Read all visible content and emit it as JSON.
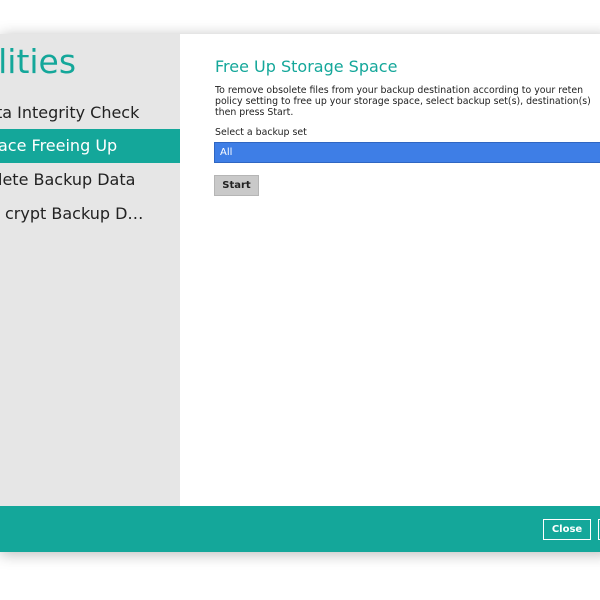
{
  "sidebar": {
    "title": "tilities",
    "items": [
      {
        "label": "ta Integrity Check",
        "active": false
      },
      {
        "label": "ace Freeing Up",
        "active": true
      },
      {
        "label": "lete Backup Data",
        "active": false
      },
      {
        "label": "crypt Backup D…",
        "active": false
      }
    ]
  },
  "main": {
    "title": "Free Up Storage Space",
    "description": "To remove obsolete files from your backup destination according to your reten\npolicy setting to free up your storage space, select backup set(s), destination(s)\nthen press Start.",
    "select_label": "Select a backup set",
    "select_value": "All",
    "start_label": "Start"
  },
  "footer": {
    "close_label": "Close"
  },
  "colors": {
    "accent": "#14a79a",
    "selection": "#3e7ee6",
    "sidebar_bg": "#e6e6e6"
  }
}
